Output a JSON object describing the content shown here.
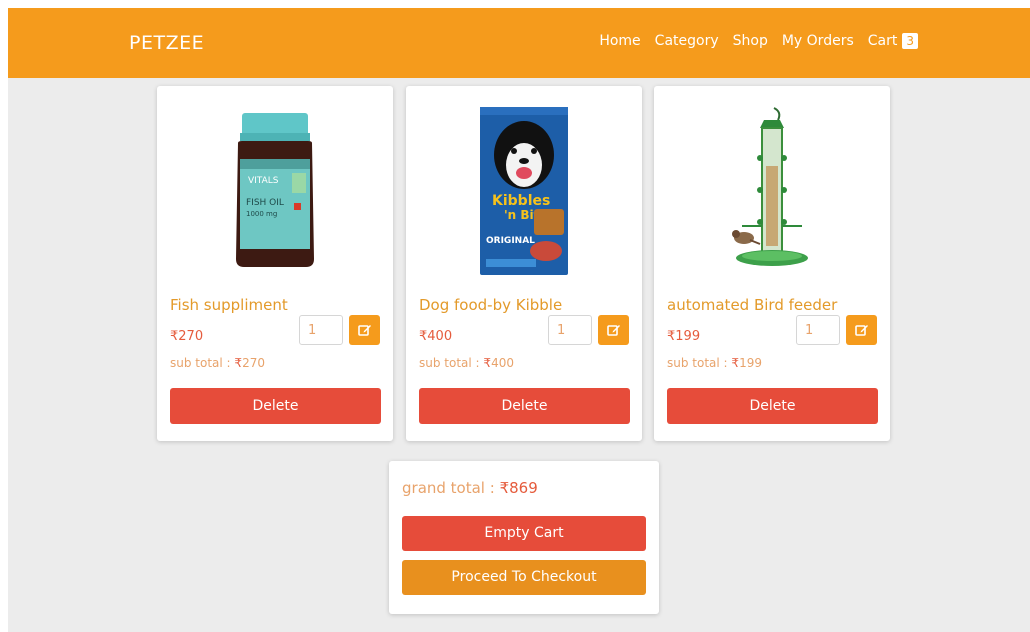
{
  "nav": {
    "brand": "PETZEE",
    "links": [
      "Home",
      "Category",
      "Shop",
      "My Orders"
    ],
    "cart_label": "Cart",
    "cart_count": "3"
  },
  "currency_symbol": "₹",
  "products": [
    {
      "name": "Fish suppliment",
      "price": "270",
      "quantity": "1",
      "subtotal_label": "sub total :",
      "subtotal": "270",
      "delete_label": "Delete",
      "image": "fish-oil-bottle"
    },
    {
      "name": "Dog food-by Kibble",
      "price": "400",
      "quantity": "1",
      "subtotal_label": "sub total :",
      "subtotal": "400",
      "delete_label": "Delete",
      "image": "dog-food-bag"
    },
    {
      "name": "automated Bird feeder",
      "price": "199",
      "quantity": "1",
      "subtotal_label": "sub total :",
      "subtotal": "199",
      "delete_label": "Delete",
      "image": "bird-feeder"
    }
  ],
  "summary": {
    "grand_total_label": "grand total :",
    "grand_total": "869",
    "empty_cart_label": "Empty Cart",
    "checkout_label": "Proceed To Checkout"
  },
  "icons": {
    "edit": "edit-icon"
  },
  "colors": {
    "brand_orange": "#f59b1c",
    "delete_red": "#e64c3a",
    "checkout_orange": "#e8901e",
    "name_orange": "#e39a2a",
    "price_red": "#e55b3c"
  }
}
